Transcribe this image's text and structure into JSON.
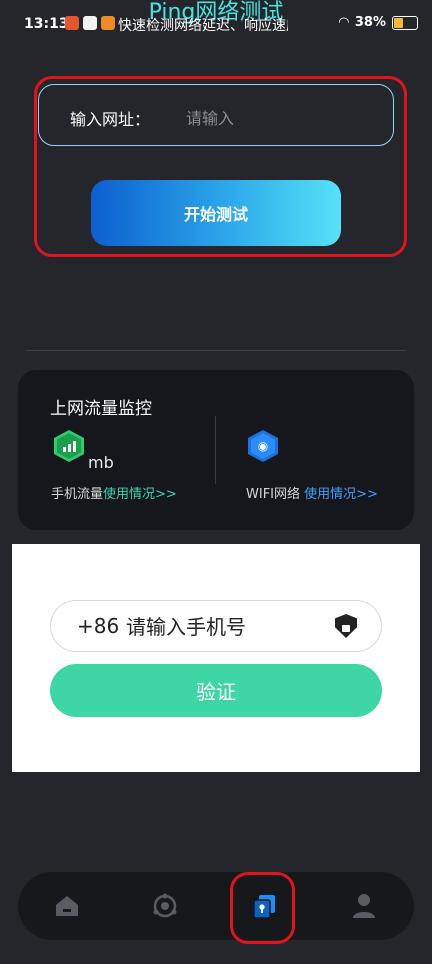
{
  "status_bar": {
    "time": "13:13",
    "marquee": "快速检测网络延迟、响应速度",
    "battery": "38%"
  },
  "header": {
    "title": "Ping网络测试"
  },
  "url_test": {
    "label": "输入网址：",
    "placeholder": "请输入",
    "start_button": "开始测试"
  },
  "monitor": {
    "title": "上网流量监控",
    "mobile_value": "",
    "mobile_unit": "mb",
    "mobile_label": "手机流量",
    "mobile_link": "使用情况>>",
    "wifi_label": "WIFI网络",
    "wifi_link": "使用情况>>"
  },
  "verify": {
    "prefix": "+86",
    "placeholder": "请输入手机号",
    "button": "验证"
  },
  "bottom_nav": {
    "items": [
      {
        "name": "home-icon",
        "active": false
      },
      {
        "name": "hub-icon",
        "active": false
      },
      {
        "name": "vault-icon",
        "active": true
      },
      {
        "name": "user-icon",
        "active": false
      }
    ]
  },
  "colors": {
    "accent_teal": "#48e3e0",
    "green": "#3ed6a5",
    "link_blue": "#3fa2ff",
    "annotation_red": "#e3131d"
  }
}
